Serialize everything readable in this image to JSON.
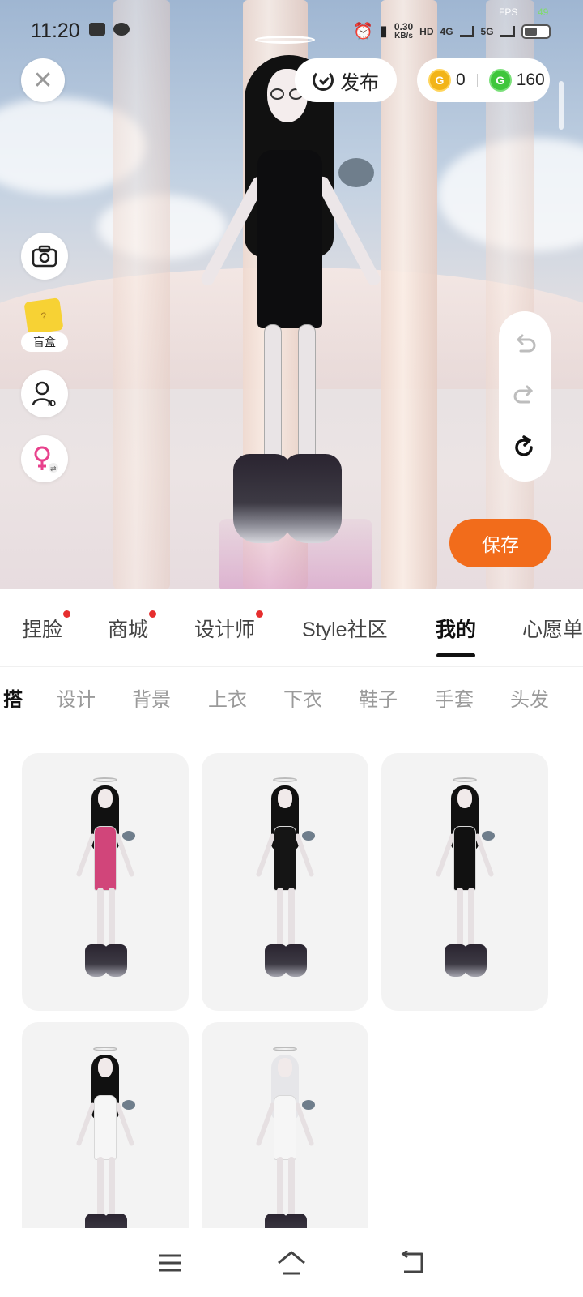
{
  "status_bar": {
    "time": "11:20",
    "fps_label": "FPS",
    "fps_value": "49",
    "net_speed_value": "0.30",
    "net_speed_unit": "KB/s",
    "hd_label": "HD",
    "network_1": "4G",
    "network_2": "5G",
    "battery_level": 0.55
  },
  "top_bar": {
    "close_icon": "close-icon",
    "publish_label": "发布",
    "gold_coin_count": "0",
    "green_coin_count": "160",
    "gold_coin_symbol": "G",
    "green_coin_symbol": "G"
  },
  "side_tools": {
    "camera_icon": "camera-icon",
    "blind_box_label": "盲盒",
    "blind_box_mark": "?",
    "id_icon": "id-card-icon",
    "gender_icon": "female-swap-icon"
  },
  "history": {
    "undo_icon": "undo-icon",
    "redo_icon": "redo-icon",
    "reset_icon": "reset-icon"
  },
  "save_label": "保存",
  "main_tabs": [
    {
      "label": "捏脸",
      "badge": true
    },
    {
      "label": "商城",
      "badge": true
    },
    {
      "label": "设计师",
      "badge": true
    },
    {
      "label": "Style社区",
      "badge": false
    },
    {
      "label": "我的",
      "badge": false,
      "active": true
    },
    {
      "label": "心愿单",
      "badge": false
    }
  ],
  "sub_tabs": [
    {
      "label": "搭",
      "active": true
    },
    {
      "label": "设计"
    },
    {
      "label": "背景"
    },
    {
      "label": "上衣"
    },
    {
      "label": "下衣"
    },
    {
      "label": "鞋子"
    },
    {
      "label": "手套"
    },
    {
      "label": "头发"
    }
  ],
  "outfits": [
    {
      "name": "outfit-pink-dress",
      "dress_color": "#d1457a",
      "hair_color": "#111111"
    },
    {
      "name": "outfit-black-red-belt",
      "dress_color": "#151515",
      "hair_color": "#111111"
    },
    {
      "name": "outfit-black-dress",
      "dress_color": "#111111",
      "hair_color": "#111111"
    },
    {
      "name": "outfit-white-hoodie",
      "dress_color": "#f6f6f6",
      "hair_color": "#111111"
    },
    {
      "name": "outfit-white-hoodie-silver-hair",
      "dress_color": "#f6f6f6",
      "hair_color": "#e6e6e9"
    }
  ],
  "nav": {
    "menu_icon": "menu-icon",
    "home_icon": "home-icon",
    "back_icon": "back-icon"
  },
  "colors": {
    "accent": "#f26c1b",
    "badge": "#e62e2e",
    "gold_coin": "#f2b418",
    "green_coin": "#3fc63c"
  }
}
